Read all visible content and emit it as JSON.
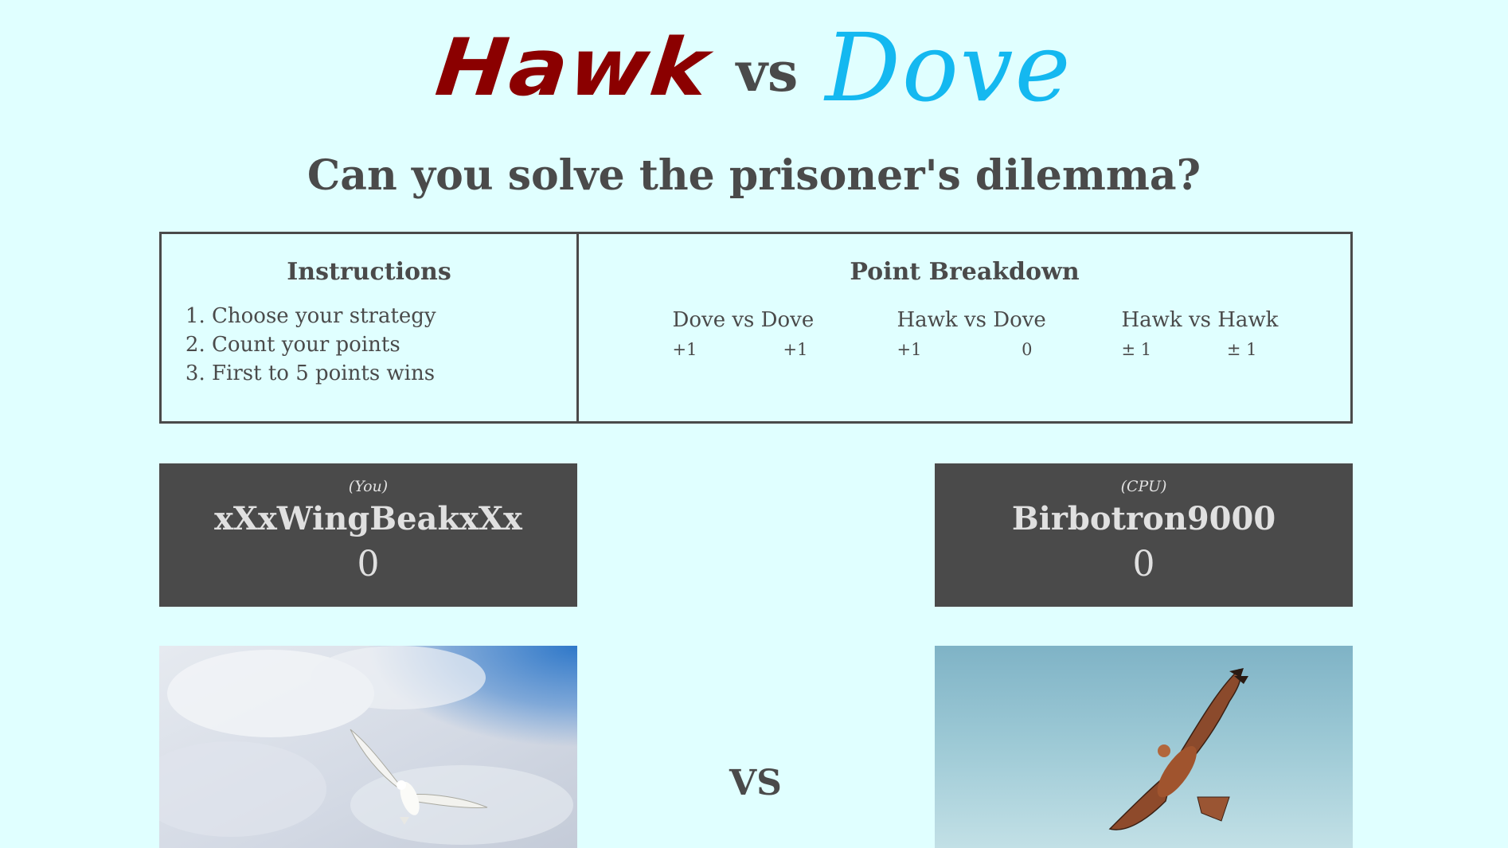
{
  "header": {
    "hawk": "Hawk",
    "vs": "vs",
    "dove": "Dove",
    "subtitle": "Can you solve the prisoner's dilemma?"
  },
  "instructions": {
    "title": "Instructions",
    "items": [
      "Choose your strategy",
      "Count your points",
      "First to 5 points wins"
    ]
  },
  "breakdown": {
    "title": "Point Breakdown",
    "matchups": [
      {
        "label": "Dove vs Dove",
        "left": "+1",
        "right": "+1"
      },
      {
        "label": "Hawk vs Dove",
        "left": "+1",
        "right": "0"
      },
      {
        "label": "Hawk vs Hawk",
        "left": "± 1",
        "right": "± 1"
      }
    ]
  },
  "player": {
    "role": "(You)",
    "name": "xXxWingBeakxXx",
    "score": "0"
  },
  "cpu": {
    "role": "(CPU)",
    "name": "Birbotron9000",
    "score": "0"
  },
  "arena": {
    "vs": "VS"
  },
  "colors": {
    "background": "#e0ffff",
    "hawk": "#8b0000",
    "dove": "#14b8f0",
    "card": "#4a4a4a"
  }
}
